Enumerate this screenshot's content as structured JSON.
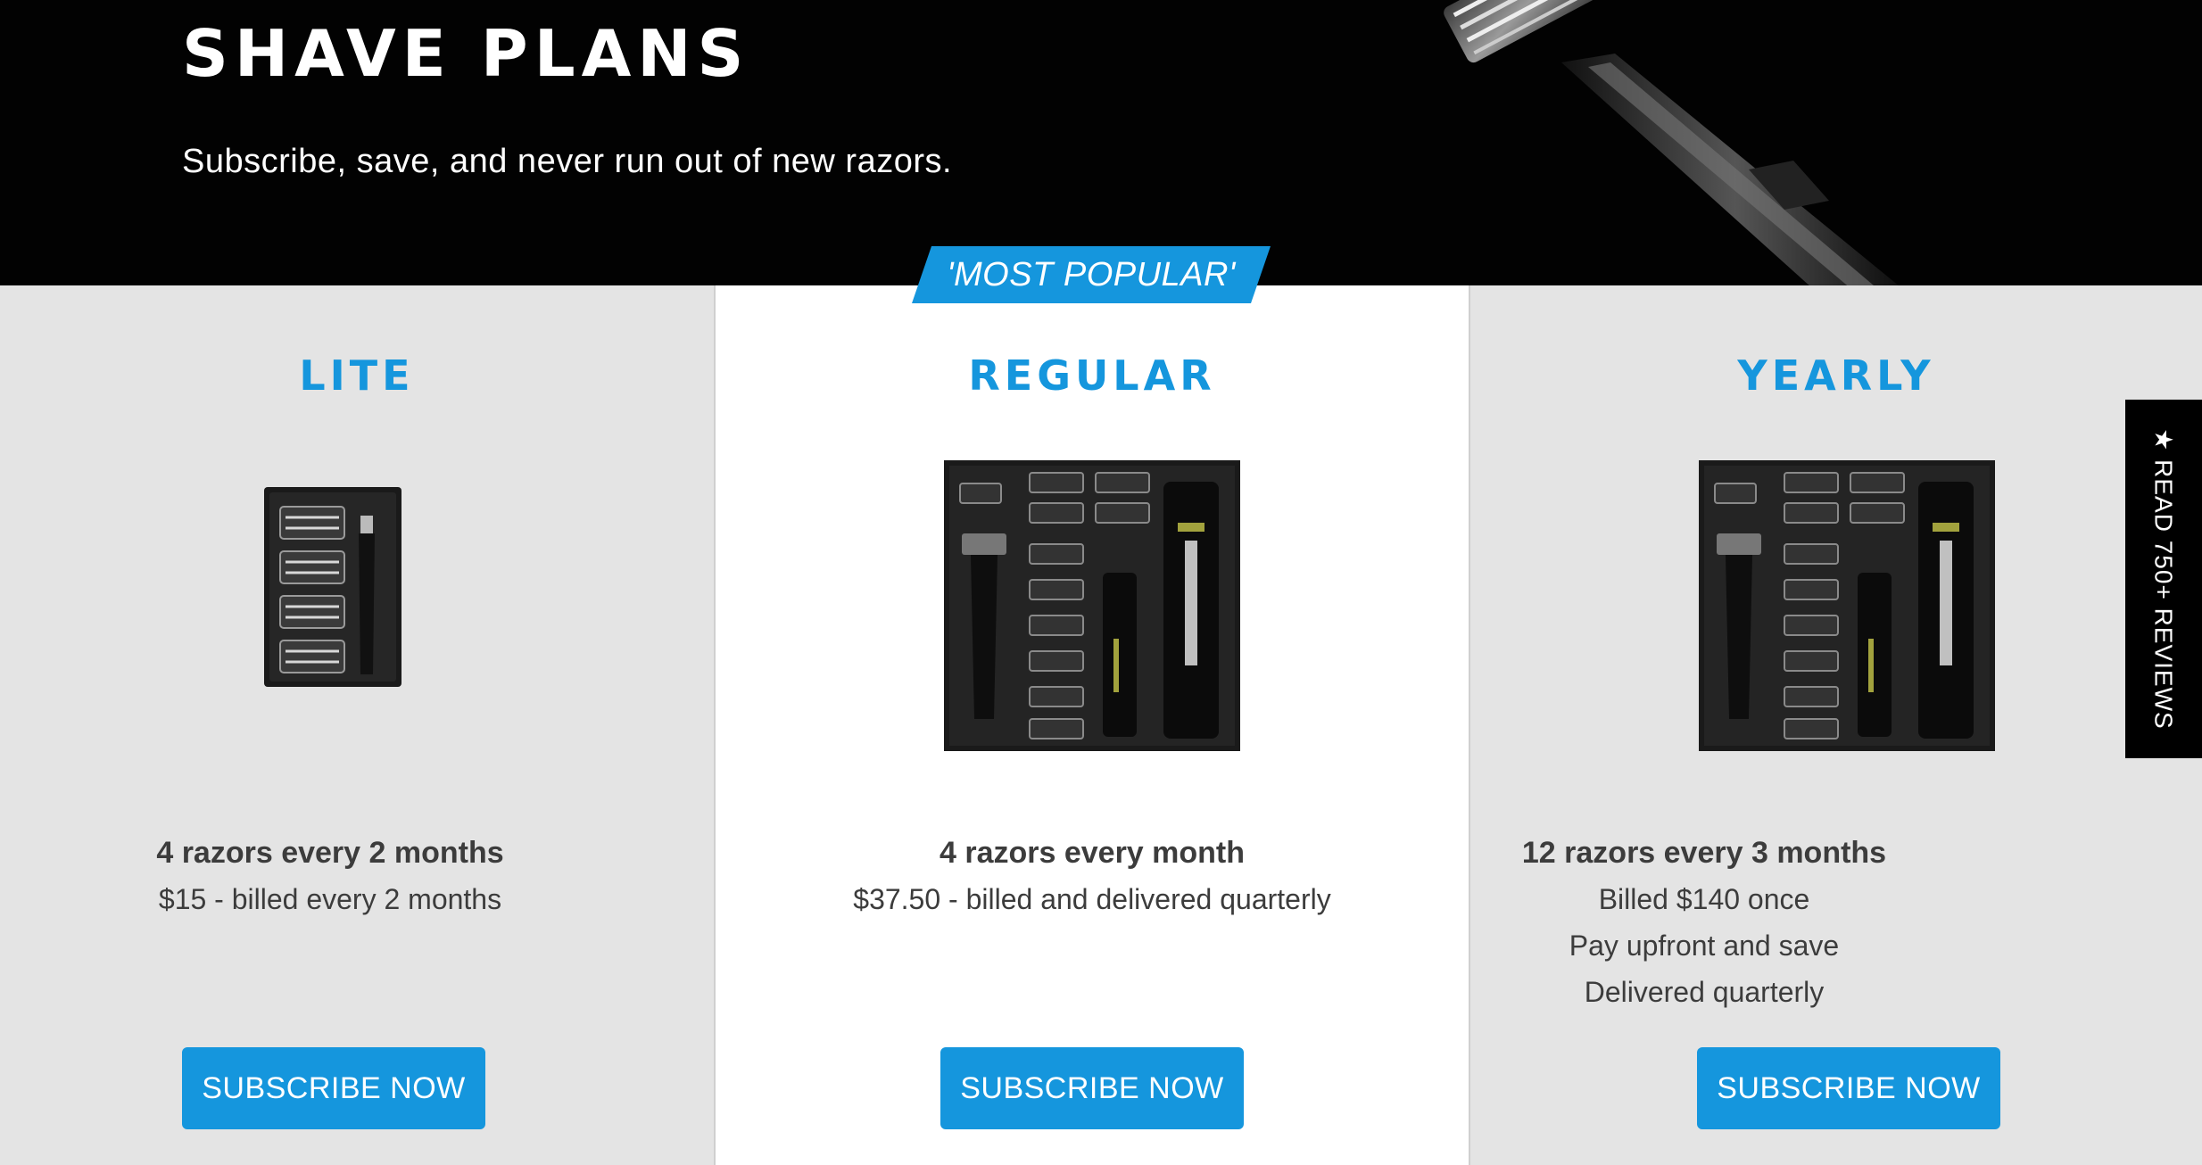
{
  "hero": {
    "title": "SHAVE PLANS",
    "subtitle": "Subscribe, save, and never run out of new razors."
  },
  "badge": {
    "label": "'MOST POPULAR'"
  },
  "plans": [
    {
      "name": "LITE",
      "headline": "4 razors every 2 months",
      "details": [
        "$15 - billed every 2 months"
      ],
      "button": "SUBSCRIBE NOW"
    },
    {
      "name": "REGULAR",
      "headline": "4 razors every month",
      "details": [
        "$37.50 - billed and delivered quarterly"
      ],
      "button": "SUBSCRIBE NOW"
    },
    {
      "name": "YEARLY",
      "headline": "12 razors every 3 months",
      "details": [
        "Billed $140 once",
        "Pay upfront and save",
        "Delivered quarterly"
      ],
      "button": "SUBSCRIBE NOW"
    }
  ],
  "reviews_tab": {
    "label": "★ READ 750+ REVIEWS"
  },
  "colors": {
    "accent": "#1596dd",
    "hero_bg": "#020202",
    "panel_grey": "#e4e4e4",
    "panel_white": "#ffffff"
  }
}
